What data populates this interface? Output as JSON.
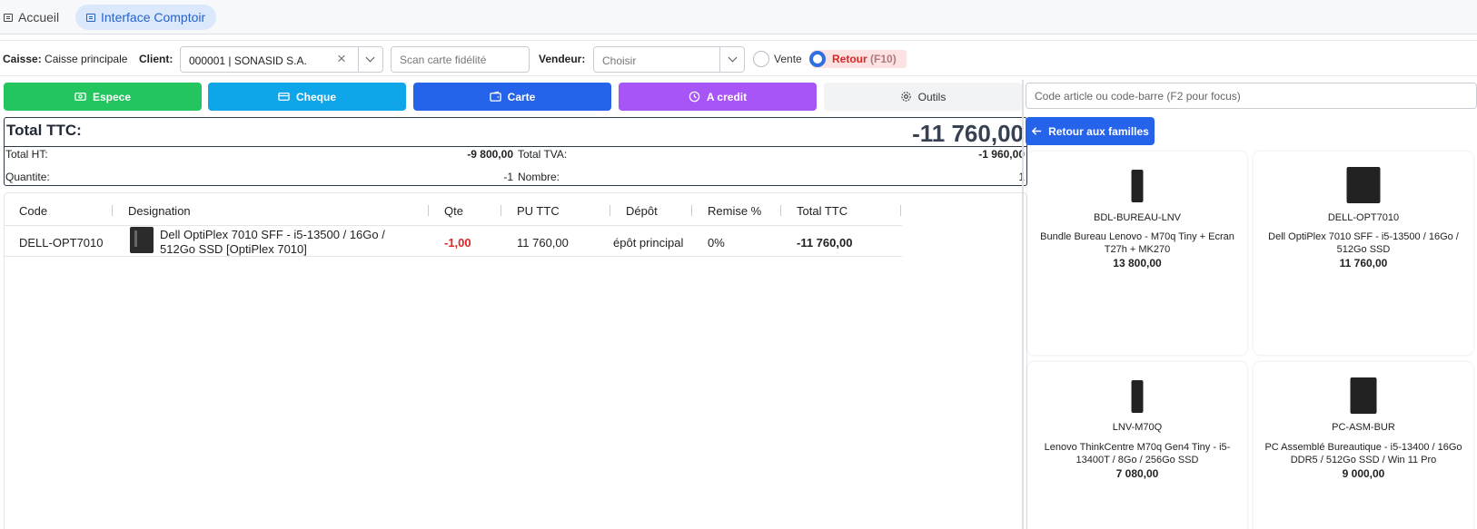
{
  "tabs": [
    {
      "label": "Accueil"
    },
    {
      "label": "Interface Comptoir"
    }
  ],
  "toolbar": {
    "caisse_label": "Caisse:",
    "caisse_value": "Caisse principale",
    "client_label": "Client:",
    "client_value": "000001 | SONASID S.A.",
    "loyalty_placeholder": "Scan carte fidélité",
    "vendeur_label": "Vendeur:",
    "vendeur_value": "Choisir",
    "vente_label": "Vente",
    "retour_label": "Retour",
    "retour_key": "(F10)",
    "mode_selected": "Retour"
  },
  "payment_buttons": [
    {
      "label": "Espece",
      "color": "#22c55e"
    },
    {
      "label": "Cheque",
      "color": "#0ea5e9"
    },
    {
      "label": "Carte",
      "color": "#2563eb"
    },
    {
      "label": "A credit",
      "color": "#a855f7"
    },
    {
      "label": "Outils",
      "color": "#f1f3f5"
    }
  ],
  "totals": {
    "ttc_label": "Total TTC:",
    "ttc_value": "-11 760,00",
    "ht_label": "Total HT:",
    "ht_value": "-9 800,00",
    "tva_label": "Total TVA:",
    "tva_value": "-1 960,00",
    "qty_label": "Quantite:",
    "qty_value": "-1",
    "count_label": "Nombre:",
    "count_value": "1"
  },
  "table": {
    "headers": [
      "Code",
      "Designation",
      "Qte",
      "PU TTC",
      "Dépôt",
      "Remise %",
      "Total TTC"
    ],
    "rows": [
      {
        "code": "DELL-OPT7010",
        "designation_1": "Dell OptiPlex 7010 SFF - i5-13500 / 16Go /",
        "designation_2": "512Go SSD [OptiPlex 7010]",
        "qte": "-1,00",
        "pu_ttc": "11 760,00",
        "depot": "épôt principal",
        "remise": "0%",
        "total_ttc": "-11 760,00"
      }
    ]
  },
  "right_panel": {
    "search_placeholder": "Code article ou code-barre (F2 pour focus)",
    "back_label": "Retour aux familles",
    "products": [
      {
        "code": "BDL-BUREAU-LNV",
        "desc_1": "Bundle Bureau Lenovo - M70q Tiny + Ecran",
        "desc_2": "T27h + MK270",
        "price": "13 800,00"
      },
      {
        "code": "DELL-OPT7010",
        "desc_1": "Dell OptiPlex 7010 SFF - i5-13500 / 16Go /",
        "desc_2": "512Go SSD",
        "price": "11 760,00"
      },
      {
        "code": "LNV-M70Q",
        "desc_1": "Lenovo ThinkCentre M70q Gen4 Tiny - i5-",
        "desc_2": "13400T / 8Go / 256Go SSD",
        "price": "7 080,00"
      },
      {
        "code": "PC-ASM-BUR",
        "desc_1": "PC Assemblé Bureautique - i5-13400 / 16Go",
        "desc_2": "DDR5 / 512Go SSD / Win 11 Pro",
        "price": "9 000,00"
      }
    ]
  },
  "colors": {
    "accent": "#2563eb",
    "negative": "#dc2626",
    "retour_bg": "#fde2e2"
  }
}
